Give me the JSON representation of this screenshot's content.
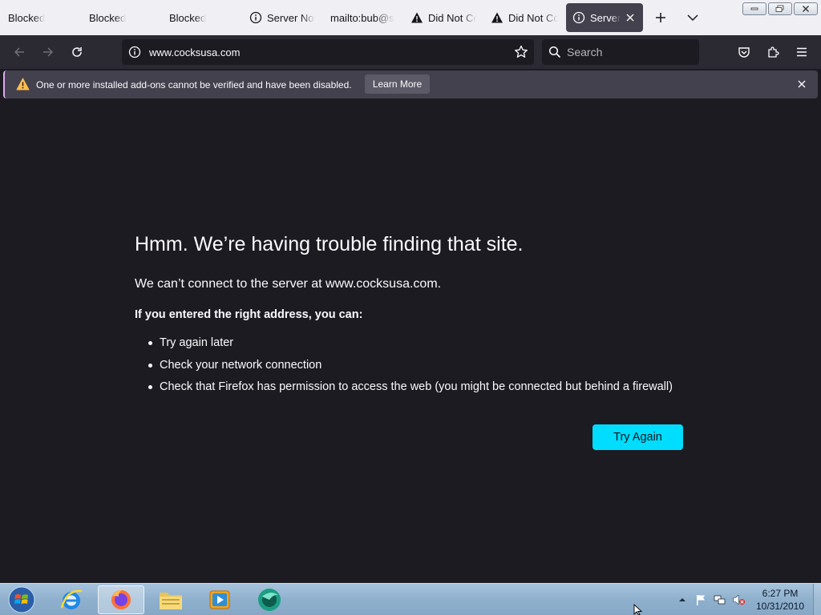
{
  "tabs": [
    {
      "label": "Blocked",
      "icon": "none"
    },
    {
      "label": "Blocked",
      "icon": "none"
    },
    {
      "label": "Blocked",
      "icon": "none"
    },
    {
      "label": "Server Not Found",
      "icon": "info-icon"
    },
    {
      "label": "mailto:bub@s",
      "icon": "none"
    },
    {
      "label": "Did Not Connect",
      "icon": "warning-icon"
    },
    {
      "label": "Did Not Connect",
      "icon": "warning-icon"
    },
    {
      "label": "Server Not Found",
      "icon": "info-icon",
      "active": true
    }
  ],
  "navbar": {
    "url": "www.cocksusa.com",
    "search_placeholder": "Search"
  },
  "notification": {
    "message": "One or more installed add-ons cannot be verified and have been disabled.",
    "learn_more": "Learn More"
  },
  "error_page": {
    "title": "Hmm. We’re having trouble finding that site.",
    "description": "We can’t connect to the server at www.cocksusa.com.",
    "subtitle": "If you entered the right address, you can:",
    "suggestions": [
      "Try again later",
      "Check your network connection",
      "Check that Firefox has permission to access the web (you might be connected but behind a firewall)"
    ],
    "try_again": "Try Again"
  },
  "taskbar": {
    "time": "6:27 PM",
    "date": "10/31/2010",
    "pinned": [
      "windows-start-icon",
      "internet-explorer-icon",
      "firefox-icon",
      "explorer-folder-icon",
      "media-player-icon",
      "app-icon"
    ]
  },
  "colors": {
    "accent": "#00ddff",
    "page_bg": "#1c1b22",
    "toolbar_bg": "#2b2a33",
    "notification_bg": "#42414d"
  }
}
